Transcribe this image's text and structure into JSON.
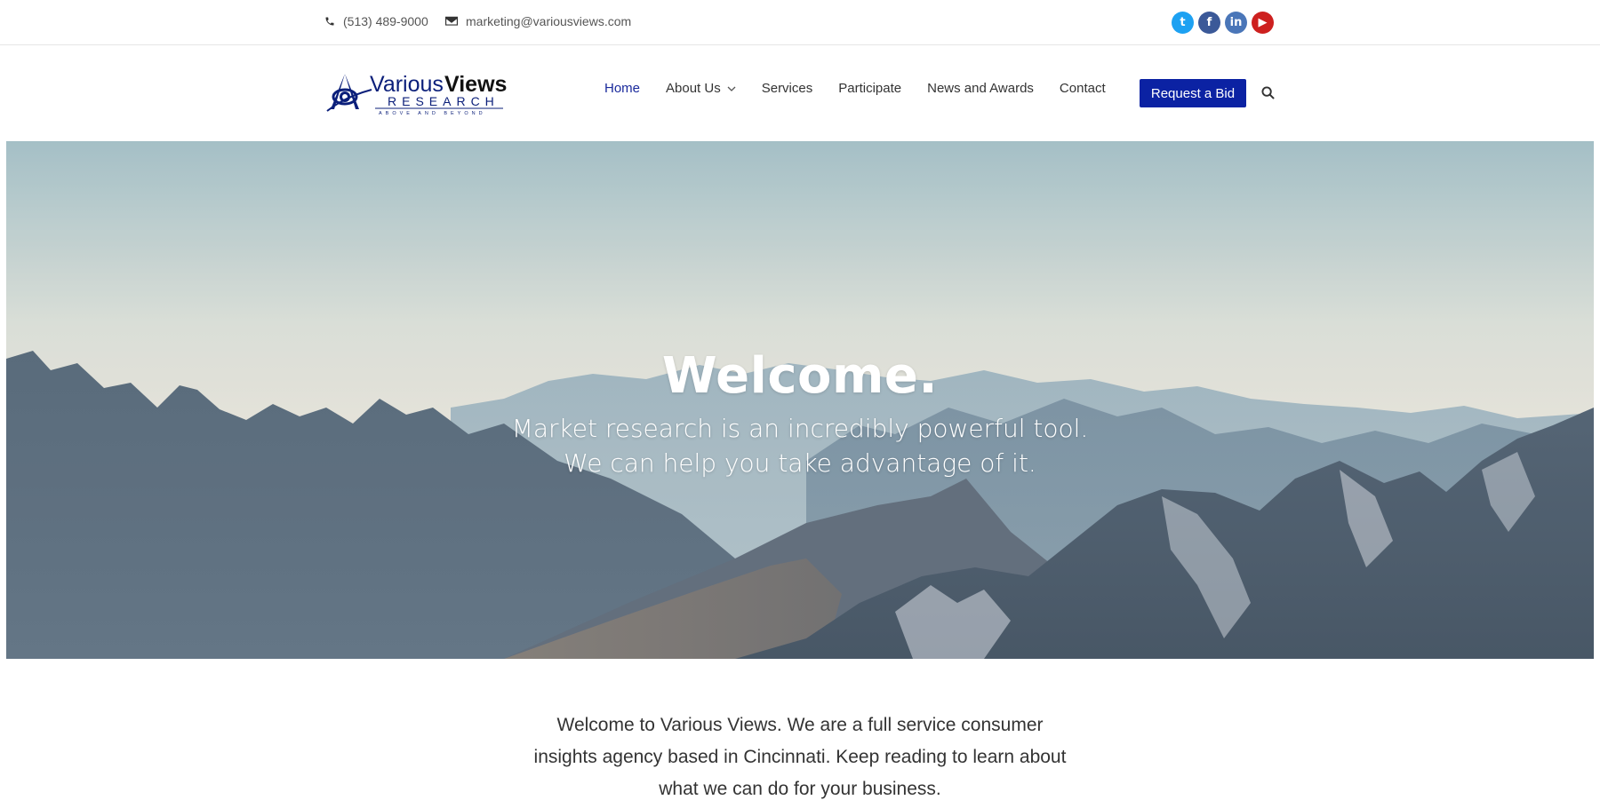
{
  "topbar": {
    "phone": "(513) 489-9000",
    "email": "marketing@variousviews.com",
    "social": [
      {
        "name": "twitter",
        "glyph": "t",
        "color": "#1da1f2"
      },
      {
        "name": "facebook",
        "glyph": "f",
        "color": "#3b5998"
      },
      {
        "name": "linkedin",
        "glyph": "in",
        "color": "#4a76b8"
      },
      {
        "name": "youtube",
        "glyph": "▶",
        "color": "#cd201f"
      }
    ]
  },
  "logo": {
    "line1_a": "Various",
    "line1_b": "Views",
    "line2": "RESEARCH",
    "tagline": "ABOVE AND BEYOND",
    "brand_color": "#0b1f7a"
  },
  "nav": {
    "items": [
      {
        "label": "Home",
        "active": true
      },
      {
        "label": "About Us",
        "has_dropdown": true
      },
      {
        "label": "Services"
      },
      {
        "label": "Participate"
      },
      {
        "label": "News and Awards"
      },
      {
        "label": "Contact"
      }
    ],
    "cta_label": "Request a Bid",
    "cta_color": "#0b22a3",
    "search_icon": "search-icon"
  },
  "hero": {
    "title": "Welcome.",
    "subtitle_line1": "Market research is an incredibly powerful tool.",
    "subtitle_line2": "We can help you take advantage of it."
  },
  "intro": {
    "line1": "Welcome to Various Views. We are a full service consumer",
    "line2": "insights agency based in Cincinnati. Keep reading to learn about",
    "line3": "what we can do for your business."
  }
}
